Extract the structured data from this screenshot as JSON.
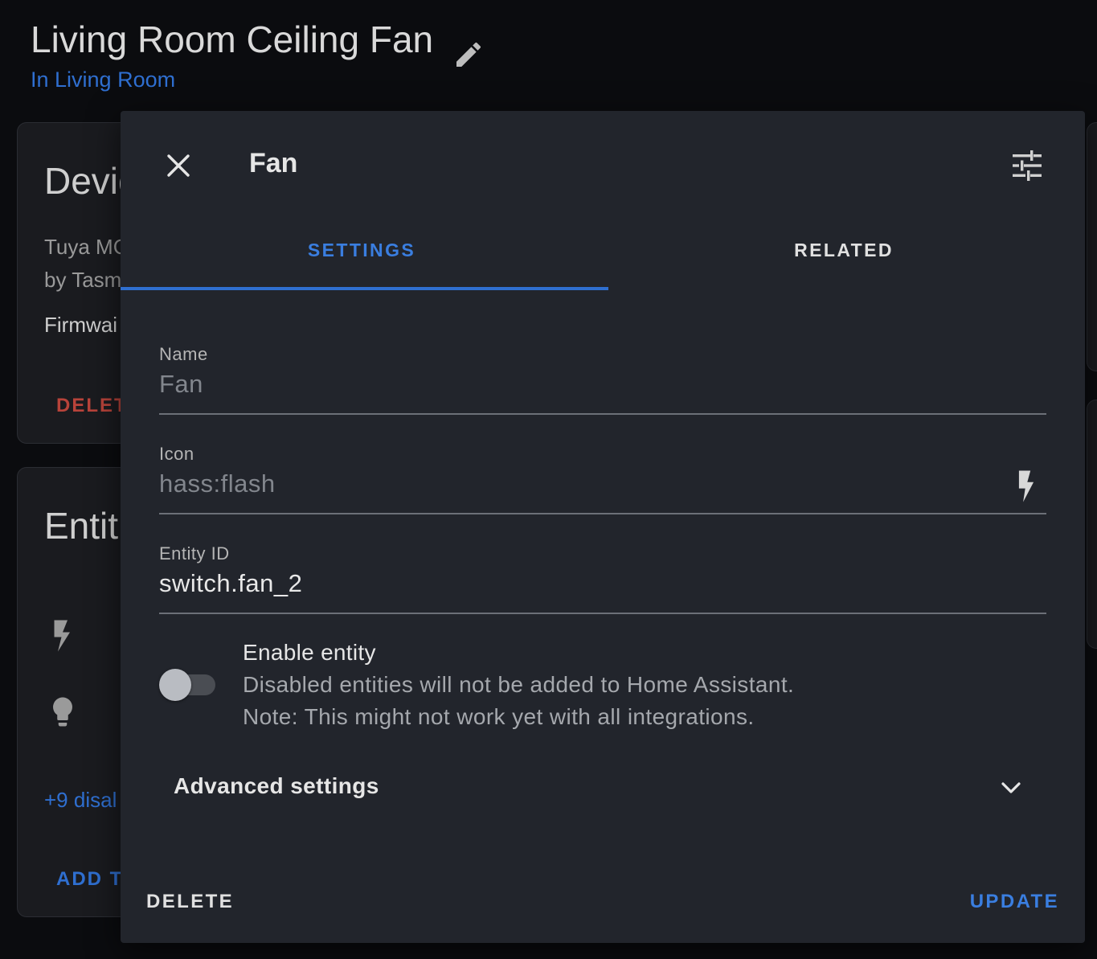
{
  "header": {
    "title": "Living Room Ceiling Fan",
    "area_link": "In Living Room",
    "edit_icon": "pencil-icon"
  },
  "background": {
    "device_card": {
      "heading": "Devic",
      "model": "Tuya MC",
      "by": "by Tasm",
      "firmware": "Firmwai",
      "delete": "DELET"
    },
    "entities_card": {
      "heading": "Entit",
      "icons": [
        "flash-icon",
        "lightbulb-icon"
      ],
      "disabled_link": "+9 disal",
      "add_link": "ADD T"
    }
  },
  "dialog": {
    "title": "Fan",
    "close_icon": "close-icon",
    "settings_icon": "tune-icon",
    "tabs": [
      {
        "label": "SETTINGS",
        "active": true
      },
      {
        "label": "RELATED",
        "active": false
      }
    ],
    "fields": {
      "name": {
        "label": "Name",
        "value": "",
        "placeholder": "Fan"
      },
      "icon": {
        "label": "Icon",
        "value": "",
        "placeholder": "hass:flash",
        "trailing_icon": "flash-icon"
      },
      "entity_id": {
        "label": "Entity ID",
        "value": "switch.fan_2"
      }
    },
    "enable": {
      "title": "Enable entity",
      "description": "Disabled entities will not be added to Home Assistant.",
      "note": "Note: This might not work yet with all integrations.",
      "enabled": false
    },
    "advanced": {
      "label": "Advanced settings",
      "expanded": false
    },
    "actions": {
      "delete": "DELETE",
      "update": "UPDATE"
    }
  },
  "colors": {
    "accent": "#2f6fd0",
    "danger": "#b8433a",
    "dialog_bg": "#22252c",
    "page_bg": "#0b0c0f"
  }
}
